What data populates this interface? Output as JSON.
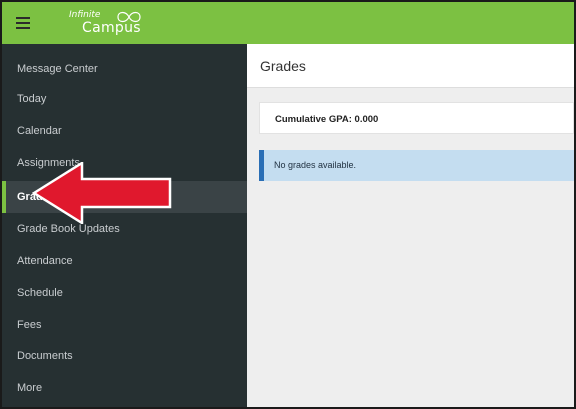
{
  "app": {
    "logo_line1": "Infinite",
    "logo_line2": "Campus"
  },
  "sidebar": {
    "items": [
      {
        "label": "Message Center",
        "active": false
      },
      {
        "label": "Today",
        "active": false
      },
      {
        "label": "Calendar",
        "active": false
      },
      {
        "label": "Assignments",
        "active": false
      },
      {
        "label": "Grades",
        "active": true
      },
      {
        "label": "Grade Book Updates",
        "active": false
      },
      {
        "label": "Attendance",
        "active": false
      },
      {
        "label": "Schedule",
        "active": false
      },
      {
        "label": "Fees",
        "active": false
      },
      {
        "label": "Documents",
        "active": false
      },
      {
        "label": "More",
        "active": false
      }
    ]
  },
  "main": {
    "title": "Grades",
    "gpa_label": "Cumulative GPA: 0.000",
    "alert_text": "No grades available."
  },
  "colors": {
    "topbar": "#7cc142",
    "sidebar": "#263032",
    "alert_bg": "#c4ddf0",
    "alert_border": "#2a6eb5",
    "annotation_arrow": "#e0182d"
  },
  "icons": {
    "menu": "hamburger-icon",
    "annotation": "red-arrow-pointer"
  }
}
